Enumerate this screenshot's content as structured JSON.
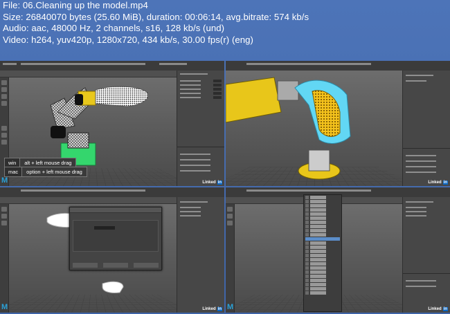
{
  "info": {
    "file": "File: 06.Cleaning up the model.mp4",
    "size": "Size: 26840070 bytes (25.60 MiB), duration: 00:06:14, avg.bitrate: 574 kb/s",
    "audio": "Audio: aac, 48000 Hz, 2 channels, s16, 128 kb/s (und)",
    "video": "Video: h264, yuv420p, 1280x720, 434 kb/s, 30.00 fps(r) (eng)"
  },
  "panel1": {
    "hint_win_key": "win",
    "hint_win_text": "alt + left mouse drag",
    "hint_mac_key": "mac",
    "hint_mac_text": "option + left mouse drag"
  },
  "logo": {
    "linkedin": "Linked",
    "linkedin_in": "in",
    "maya": "M"
  },
  "colors": {
    "background": "#4470b0",
    "accent_yellow": "#e8c61a",
    "accent_green": "#3ad36b",
    "accent_cyan": "#5fd6f2"
  }
}
